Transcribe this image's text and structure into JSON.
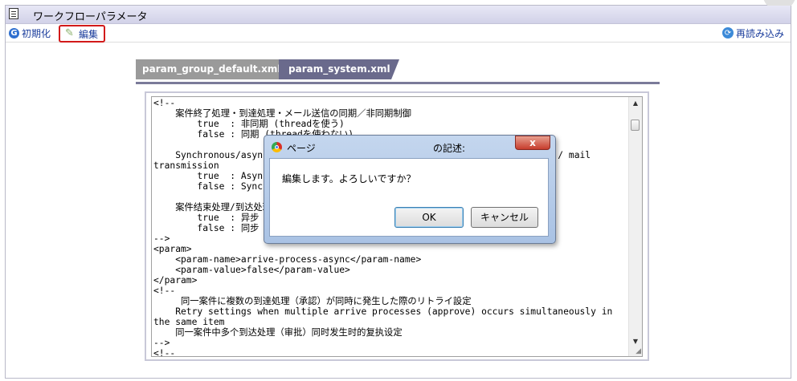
{
  "header": {
    "title": "ワークフローパラメータ"
  },
  "toolbar": {
    "init_label": "初期化",
    "edit_label": "編集",
    "reload_label": "再読み込み"
  },
  "tabs": [
    {
      "label": "param_group_default.xml",
      "active": false
    },
    {
      "label": "param_system.xml",
      "active": true
    }
  ],
  "editor": {
    "content": "<!--\n    案件終了処理・到達処理・メール送信の同期／非同期制御\n        true  : 非同期 (threadを使う)\n        false : 同期 (threadを使わない)\n\n    Synchronous/asynchronous control of end processing, arrive processing / mail\ntransmission\n        true  : Asynchronous (use thread)\n        false : Synchronous (do not use thread)\n\n    案件结束处理/到达处理/邮件发送的同步/异步控制\n        true  : 异步 (使用thread)\n        false : 同步 (不使用thread)\n-->\n<param>\n    <param-name>arrive-process-async</param-name>\n    <param-value>false</param-value>\n</param>\n<!--\n     同一案件に複数の到達処理（承認）が同時に発生した際のリトライ設定\n    Retry settings when multiple arrive processes (approve) occurs simultaneously in\nthe same item\n    同一案件中多个到达处理（审批）同时发生时的复执设定\n-->\n<!--"
  },
  "dialog": {
    "title_left": "ページ",
    "title_right": "の記述:",
    "close_label": "x",
    "message": "編集します。よろしいですか？",
    "ok_label": "OK",
    "cancel_label": "キャンセル"
  }
}
